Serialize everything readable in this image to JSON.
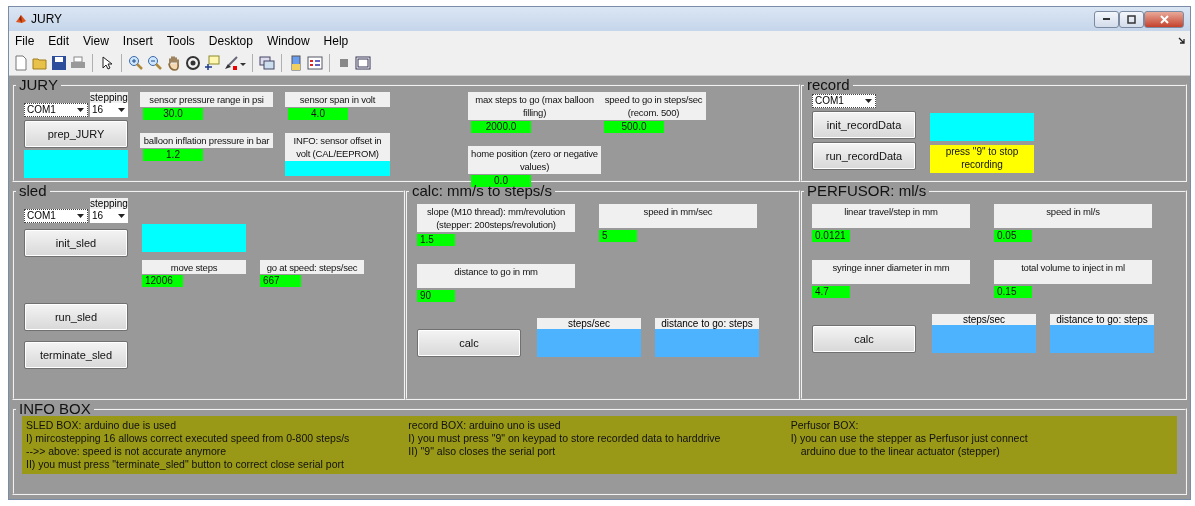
{
  "window": {
    "title": "JURY"
  },
  "menu": [
    "File",
    "Edit",
    "View",
    "Insert",
    "Tools",
    "Desktop",
    "Window",
    "Help"
  ],
  "jury": {
    "title": "JURY",
    "port": "COM1",
    "stepping_label": "stepping",
    "stepping": "16",
    "button": "prep_JURY",
    "columns": [
      [
        {
          "kind": "input",
          "label": "sensor pressure range in psi",
          "value": "30.0"
        },
        {
          "kind": "input",
          "label": "balloon inflation pressure in bar",
          "value": "1.2"
        }
      ],
      [
        {
          "kind": "input",
          "label": "sensor span in volt",
          "value": "4.0"
        },
        {
          "kind": "display",
          "label": "INFO: sensor offset in volt (CAL/EEPROM)"
        }
      ],
      [
        {
          "kind": "input",
          "label": "max steps to go (max balloon filling)",
          "value": "2000.0"
        },
        {
          "kind": "input",
          "label": "home position (zero or negative values)",
          "value": "0.0"
        }
      ],
      [
        {
          "kind": "input",
          "label": "speed to go in steps/sec (recom. 500)",
          "value": "500.0"
        }
      ]
    ]
  },
  "record": {
    "title": "record",
    "port": "COM1",
    "buttons": [
      "init_recordData",
      "run_recordData"
    ],
    "message": "press \"9\" to stop recording"
  },
  "sled": {
    "title": "sled",
    "port": "COM1",
    "stepping_label": "stepping",
    "stepping": "16",
    "buttons": [
      "init_sled",
      "run_sled",
      "terminate_sled"
    ],
    "fields": [
      {
        "label": "move steps",
        "value": "12006"
      },
      {
        "label": "go at speed: steps/sec",
        "value": "667"
      }
    ]
  },
  "calc": {
    "title": "calc: mm/s to steps/s",
    "columns": [
      [
        {
          "label": "slope (M10 thread): mm/revolution (stepper: 200steps/revolution)",
          "value": "1.5"
        },
        {
          "label": "distance to go in mm",
          "value": "90"
        }
      ],
      [
        {
          "label": "speed in mm/sec",
          "value": "5"
        }
      ]
    ],
    "button": "calc",
    "outputs": [
      "steps/sec",
      "distance to go: steps"
    ]
  },
  "perfusor": {
    "title": "PERFUSOR: ml/s",
    "columns": [
      [
        {
          "label": "linear travel/step in mm",
          "value": "0.0121"
        },
        {
          "label": "syringe inner diameter in mm",
          "value": "4.7"
        }
      ],
      [
        {
          "label": "speed in ml/s",
          "value": "0.05"
        },
        {
          "label": "total volume to inject in ml",
          "value": "0.15"
        }
      ]
    ],
    "button": "calc",
    "outputs": [
      "steps/sec",
      "distance to go: steps"
    ]
  },
  "info_box": {
    "title": "INFO BOX",
    "columns": [
      [
        {
          "text": "SLED BOX: arduino due is used",
          "continued": false
        },
        {
          "text": "I) mircostepping 16 allows correct executed speed from 0-800 steps/s",
          "continued": false
        },
        {
          "text": "-->> above: speed is not accurate anymore",
          "continued": false
        },
        {
          "text": "II) you must press \"terminate_sled\" button to correct close serial port",
          "continued": false
        }
      ],
      [
        {
          "text": "record BOX: arduino uno is used",
          "continued": false
        },
        {
          "text": "I) you must press \"9\" on keypad to store recorded data to harddrive",
          "continued": false
        },
        {
          "text": "II) \"9\" also closes the serial port",
          "continued": false
        }
      ],
      [
        {
          "text": "Perfusor BOX:",
          "continued": false
        },
        {
          "text": "I) you can use the stepper as Perfusor just connect",
          "continued": false
        },
        {
          "text": "arduino due to the linear actuator (stepper)",
          "continued": true
        }
      ]
    ]
  }
}
